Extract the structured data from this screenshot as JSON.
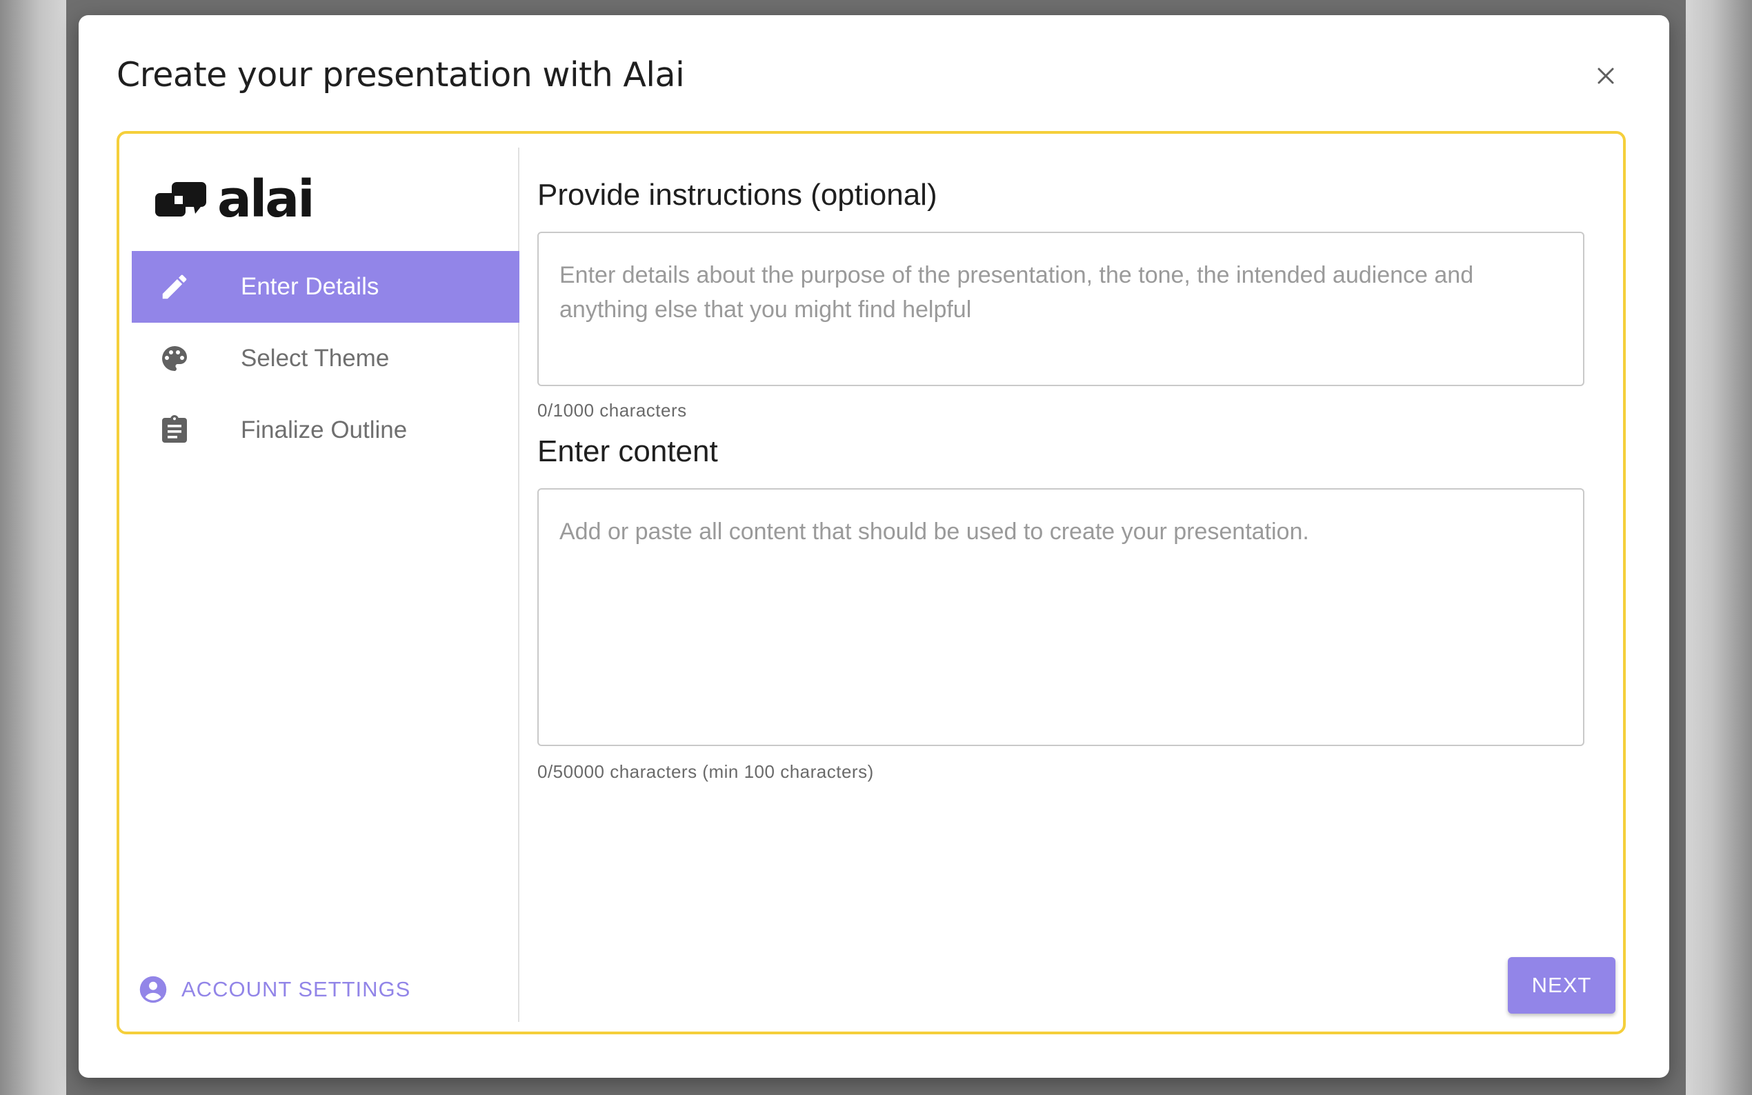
{
  "dialog": {
    "title": "Create your presentation with Alai"
  },
  "brand": {
    "logo_text": "alai",
    "accent_color": "#9285e8",
    "highlight_border_color": "#f5cf3b"
  },
  "sidebar": {
    "items": [
      {
        "label": "Enter Details",
        "icon": "pencil-icon",
        "active": true
      },
      {
        "label": "Select Theme",
        "icon": "palette-icon",
        "active": false
      },
      {
        "label": "Finalize Outline",
        "icon": "clipboard-icon",
        "active": false
      }
    ],
    "account_label": "ACCOUNT SETTINGS"
  },
  "form": {
    "instructions": {
      "label": "Provide instructions (optional)",
      "placeholder": "Enter details about the purpose of the presentation, the tone, the intended audience and anything else that you might find helpful",
      "value": "",
      "counter": "0/1000 characters"
    },
    "content": {
      "label": "Enter content",
      "placeholder": "Add or paste all content that should be used to create your presentation.",
      "value": "",
      "counter": "0/50000 characters (min 100 characters)"
    }
  },
  "actions": {
    "next_label": "NEXT"
  }
}
